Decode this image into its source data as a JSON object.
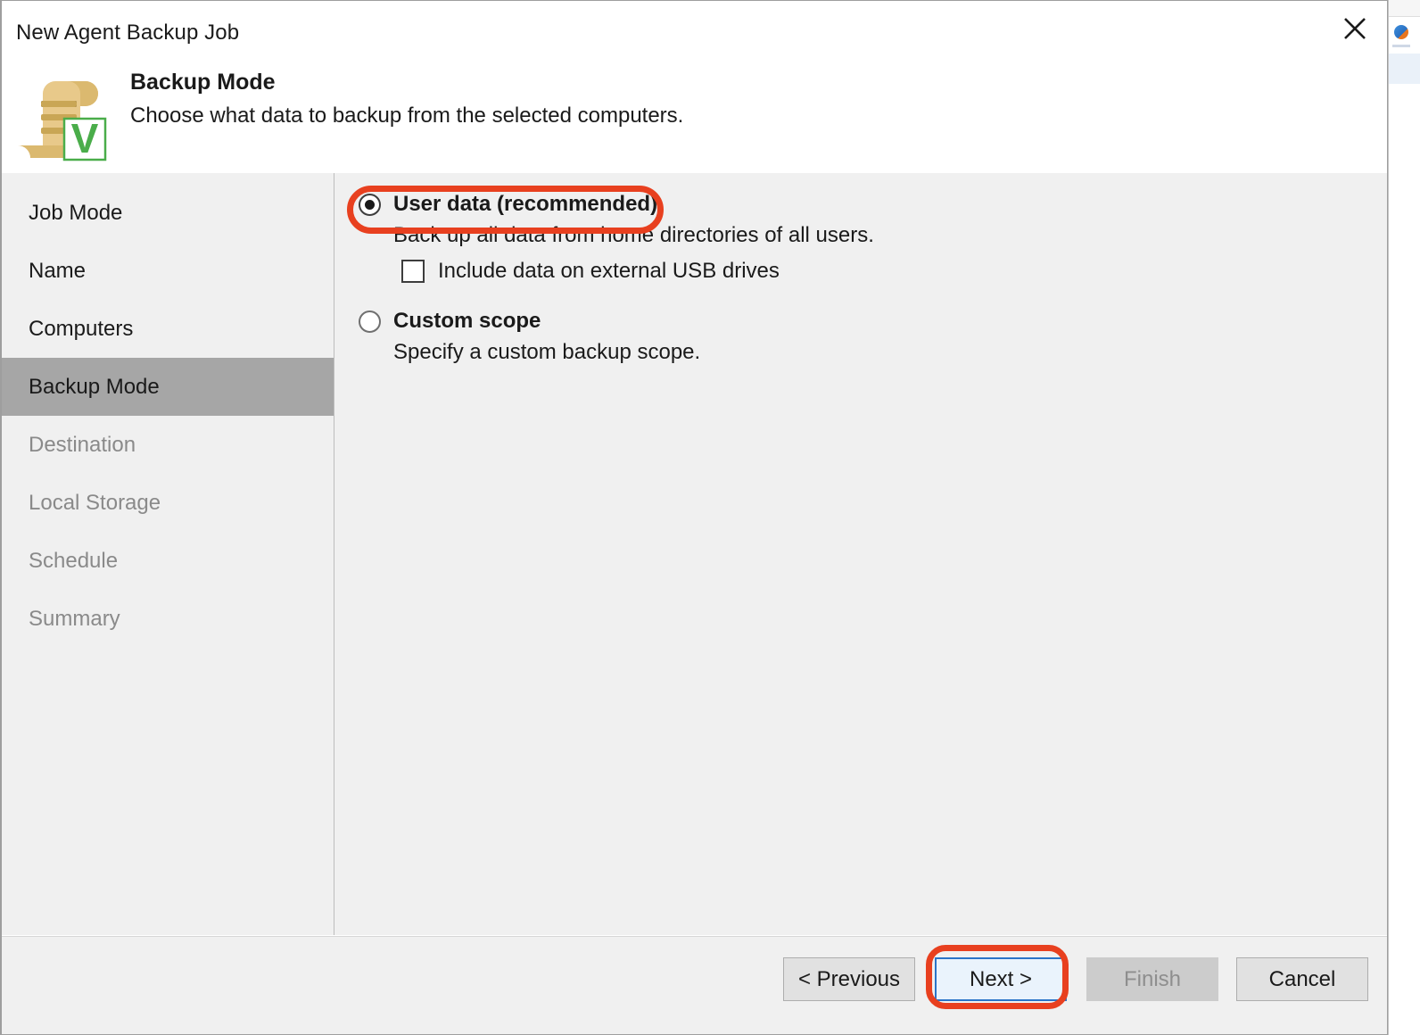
{
  "window": {
    "title": "New Agent Backup Job",
    "close_icon": "close-icon"
  },
  "header": {
    "icon": "backup-job-scroll-veeam-icon",
    "badge_letter": "V",
    "title": "Backup Mode",
    "subtitle": "Choose what data to backup from the selected computers."
  },
  "sidebar": {
    "items": [
      {
        "label": "Job Mode",
        "state": "done"
      },
      {
        "label": "Name",
        "state": "done"
      },
      {
        "label": "Computers",
        "state": "done"
      },
      {
        "label": "Backup Mode",
        "state": "active"
      },
      {
        "label": "Destination",
        "state": "upcoming"
      },
      {
        "label": "Local Storage",
        "state": "upcoming"
      },
      {
        "label": "Schedule",
        "state": "upcoming"
      },
      {
        "label": "Summary",
        "state": "upcoming"
      }
    ]
  },
  "main": {
    "options": [
      {
        "label": "User data (recommended)",
        "description": "Back up all data from home directories of all users.",
        "selected": true,
        "checkbox": {
          "label": "Include data on external USB drives",
          "checked": false
        }
      },
      {
        "label": "Custom scope",
        "description": "Specify a custom backup scope.",
        "selected": false
      }
    ]
  },
  "footer": {
    "buttons": [
      {
        "label": "< Previous",
        "style": "normal"
      },
      {
        "label": "Next >",
        "style": "default"
      },
      {
        "label": "Finish",
        "style": "disabled"
      },
      {
        "label": "Cancel",
        "style": "normal"
      }
    ]
  },
  "annotations": {
    "color": "#e8401f",
    "targets": [
      "User data (recommended)",
      "Next >"
    ]
  }
}
